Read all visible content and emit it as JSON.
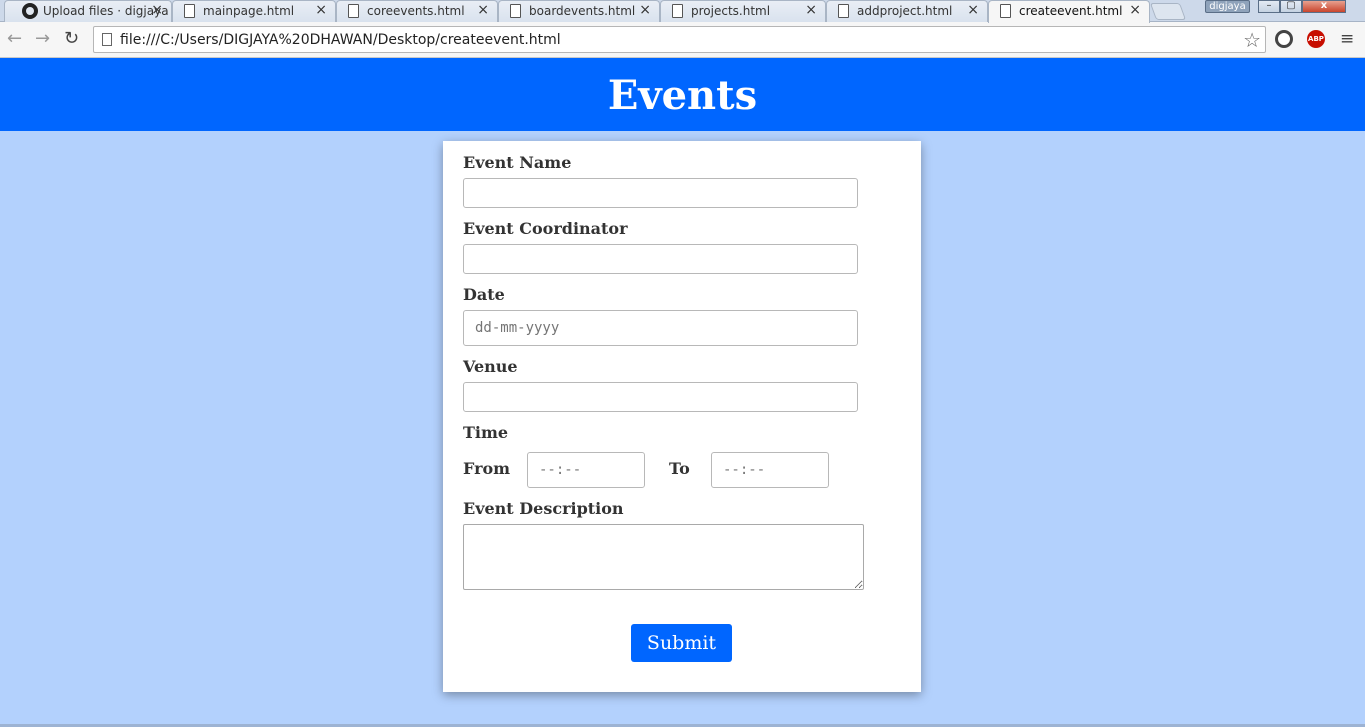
{
  "browser": {
    "tabs": [
      {
        "label": "Upload files · digjaya",
        "icon": "github-icon"
      },
      {
        "label": "mainpage.html",
        "icon": "page-icon"
      },
      {
        "label": "coreevents.html",
        "icon": "page-icon"
      },
      {
        "label": "boardevents.html",
        "icon": "page-icon"
      },
      {
        "label": "projects.html",
        "icon": "page-icon"
      },
      {
        "label": "addproject.html",
        "icon": "page-icon"
      },
      {
        "label": "createevent.html",
        "icon": "page-icon",
        "active": true
      }
    ],
    "profile": "digjaya",
    "url": "file:///C:/Users/DIGJAYA%20DHAWAN/Desktop/createevent.html",
    "close_glyph": "×",
    "back_glyph": "←",
    "forward_glyph": "→",
    "reload_glyph": "↻",
    "star_glyph": "☆",
    "menu_glyph": "≡",
    "abp_label": "ABP",
    "win_minimize": "–",
    "win_restore": "▢",
    "win_close": "x"
  },
  "page": {
    "title": "Events",
    "colors": {
      "header": "#0066ff",
      "background": "#b3d1fd",
      "button": "#0066ff"
    },
    "form": {
      "event_name_label": "Event Name",
      "event_name_value": "",
      "coordinator_label": "Event Coordinator",
      "coordinator_value": "",
      "date_label": "Date",
      "date_placeholder": "dd-mm-yyyy",
      "venue_label": "Venue",
      "venue_value": "",
      "time_label": "Time",
      "from_label": "From",
      "from_placeholder": "--:--",
      "to_label": "To",
      "to_placeholder": "--:--",
      "description_label": "Event Description",
      "description_value": "",
      "submit_label": "Submit"
    }
  }
}
